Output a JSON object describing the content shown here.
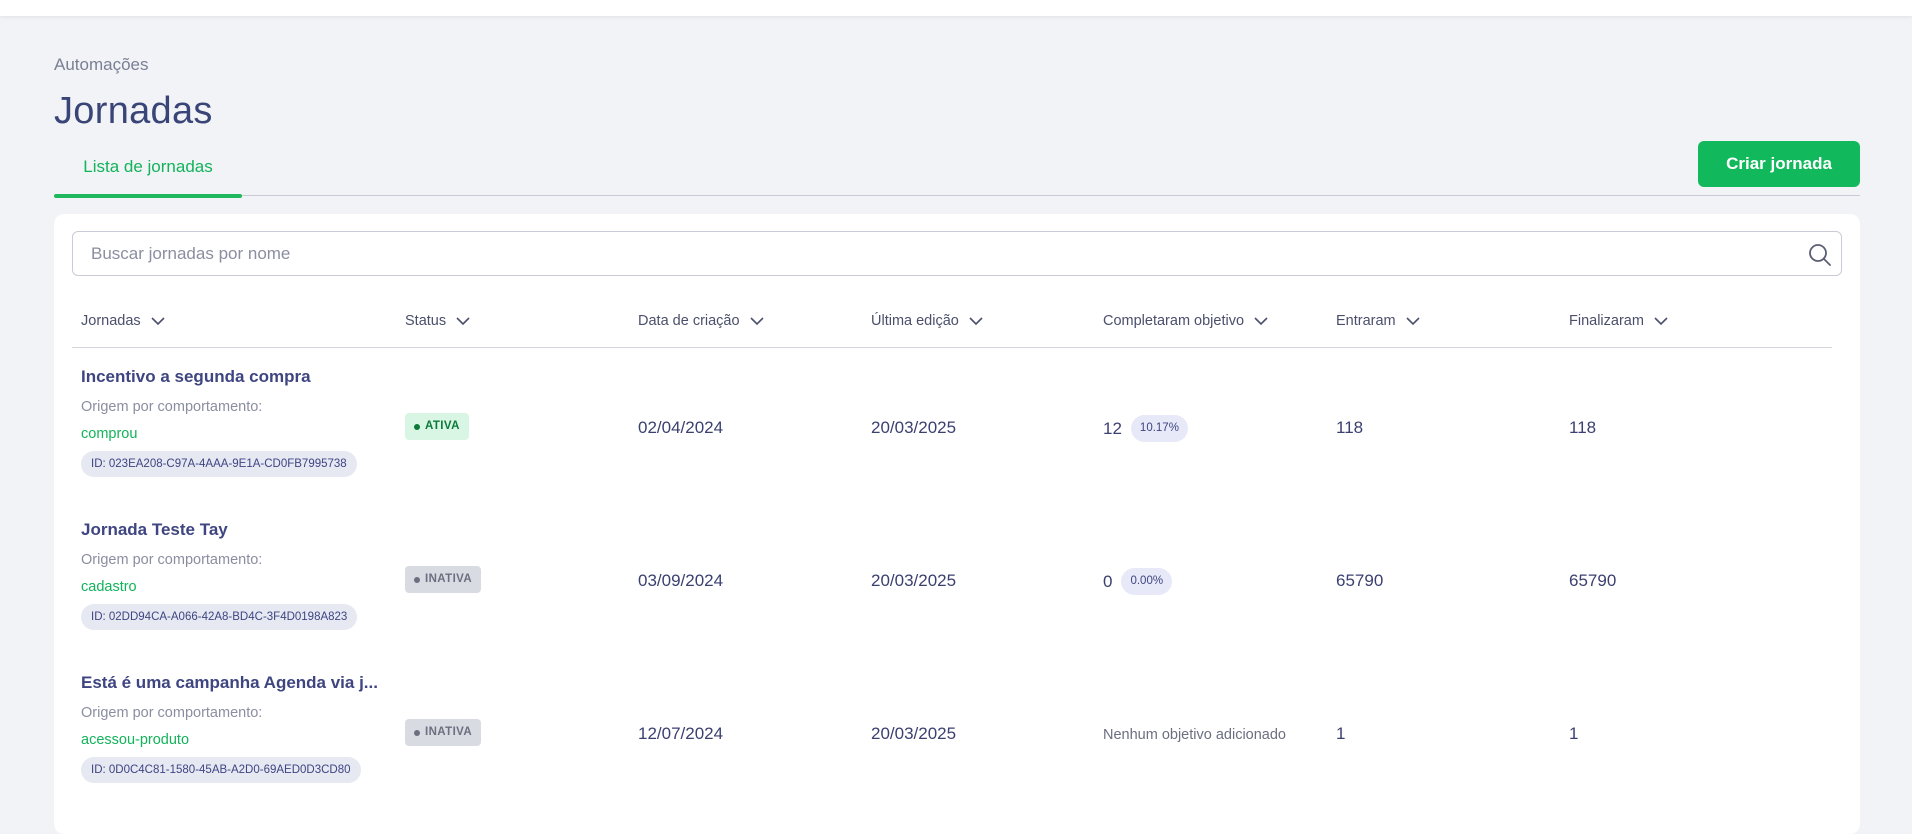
{
  "breadcrumb": "Automações",
  "page_title": "Jornadas",
  "tabs": [
    {
      "label": "Lista de jornadas",
      "active": true
    }
  ],
  "create_button": "Criar jornada",
  "search": {
    "placeholder": "Buscar jornadas por nome",
    "value": ""
  },
  "columns": [
    "Jornadas",
    "Status",
    "Data de criação",
    "Última edição",
    "Completaram objetivo",
    "Entraram",
    "Finalizaram"
  ],
  "rows": [
    {
      "name": "Incentivo a segunda compra",
      "origin": "Origem por comportamento:",
      "event": "comprou",
      "id": "ID: 023EA208-C97A-4AAA-9E1A-CD0FB7995738",
      "status": "ATIVA",
      "created": "02/04/2024",
      "edited": "20/03/2025",
      "goal_count": "12",
      "goal_pct": "10.17%",
      "goal_text": "",
      "entered": "118",
      "finished": "118"
    },
    {
      "name": "Jornada Teste Tay",
      "origin": "Origem por comportamento:",
      "event": "cadastro",
      "id": "ID: 02DD94CA-A066-42A8-BD4C-3F4D0198A823",
      "status": "INATIVA",
      "created": "03/09/2024",
      "edited": "20/03/2025",
      "goal_count": "0",
      "goal_pct": "0.00%",
      "goal_text": "",
      "entered": "65790",
      "finished": "65790"
    },
    {
      "name": "Está é uma campanha Agenda via j...",
      "origin": "Origem por comportamento:",
      "event": "acessou-produto",
      "id": "ID: 0D0C4C81-1580-45AB-A2D0-69AED0D3CD80",
      "status": "INATIVA",
      "created": "12/07/2024",
      "edited": "20/03/2025",
      "goal_count": "",
      "goal_pct": "",
      "goal_text": "Nenhum objetivo adicionado",
      "entered": "1",
      "finished": "1"
    }
  ],
  "colors": {
    "accent": "#12b85c",
    "title": "#3a4577",
    "active_badge": "#d9f5e3",
    "inactive_badge": "#d9dbe2"
  }
}
